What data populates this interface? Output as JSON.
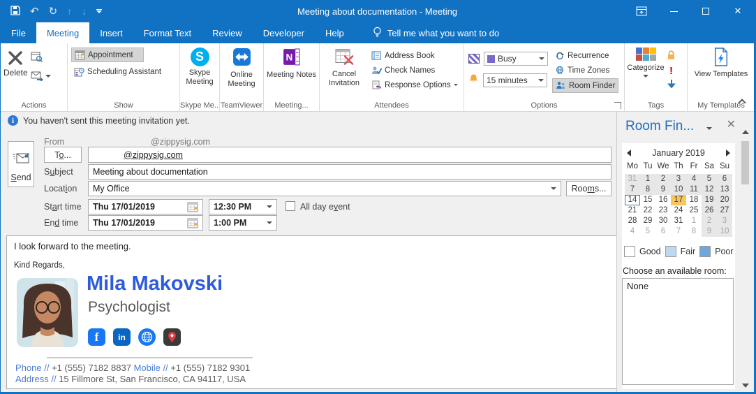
{
  "colors": {
    "accent": "#1172C4",
    "selected_day": "#F7C75C",
    "busy_status": "#7A68C8",
    "name_blue": "#2E5BDB",
    "link_blue": "#4A7DD6"
  },
  "window": {
    "title": "Meeting about documentation  -  Meeting"
  },
  "tabs": [
    {
      "label": "File",
      "selected": false
    },
    {
      "label": "Meeting",
      "selected": true
    },
    {
      "label": "Insert",
      "selected": false
    },
    {
      "label": "Format Text",
      "selected": false
    },
    {
      "label": "Review",
      "selected": false
    },
    {
      "label": "Developer",
      "selected": false
    },
    {
      "label": "Help",
      "selected": false
    }
  ],
  "tellme": "Tell me what you want to do",
  "ribbon": {
    "actions": {
      "label": "Actions",
      "delete": "Delete"
    },
    "show": {
      "label": "Show",
      "appointment": "Appointment",
      "scheduling": "Scheduling Assistant"
    },
    "skype": {
      "label": "Skype Me...",
      "button": "Skype Meeting"
    },
    "teamviewer": {
      "label": "TeamViewer",
      "button": "Online Meeting"
    },
    "notes": {
      "label": "Meeting...",
      "button": "Meeting Notes"
    },
    "attendees": {
      "label": "Attendees",
      "cancel": "Cancel Invitation",
      "address_book": "Address Book",
      "check_names": "Check Names",
      "response_options": "Response Options"
    },
    "options": {
      "label": "Options",
      "busy": "Busy",
      "reminder": "15 minutes",
      "recurrence": "Recurrence",
      "time_zones": "Time Zones",
      "room_finder": "Room Finder"
    },
    "tags": {
      "label": "Tags",
      "categorize": "Categorize"
    },
    "templates": {
      "label": "My Templates",
      "button": "View Templates"
    }
  },
  "infobar": {
    "text": "You haven't sent this meeting invitation yet."
  },
  "form": {
    "send": "Send",
    "from_label": "From",
    "from_value": "@zippysig.com",
    "to_button": "To...",
    "to_value": "@zippysig.com",
    "subject_label": "Subject",
    "subject_value": "Meeting about documentation",
    "location_label": "Location",
    "location_value": "My Office",
    "rooms_button": "Rooms...",
    "start_label": "Start time",
    "start_date": "Thu 17/01/2019",
    "start_time": "12:30 PM",
    "all_day": "All day event",
    "end_label": "End time",
    "end_date": "Thu 17/01/2019",
    "end_time": "1:00 PM"
  },
  "message": {
    "greeting": "I look forward to the meeting.",
    "signoff": "Kind Regards,",
    "name": "Mila Makovski",
    "role": "Psychologist",
    "phone_label": "Phone",
    "sep": "//",
    "phone_value": "+1 (555) 7182 8837",
    "mobile_label": "Mobile",
    "mobile_value": "+1 (555) 7182 9301",
    "address_label": "Address",
    "address_value": "15 Fillmore St, San Francisco, CA 94117, USA"
  },
  "room_finder": {
    "title": "Room Fin...",
    "month": "January 2019",
    "weekdays": [
      "Mo",
      "Tu",
      "We",
      "Th",
      "Fr",
      "Sa",
      "Su"
    ],
    "days": [
      {
        "d": "31",
        "c": "muted shaded"
      },
      {
        "d": "1",
        "c": "shaded"
      },
      {
        "d": "2",
        "c": "shaded"
      },
      {
        "d": "3",
        "c": "shaded"
      },
      {
        "d": "4",
        "c": "shaded"
      },
      {
        "d": "5",
        "c": "shaded"
      },
      {
        "d": "6",
        "c": "shaded"
      },
      {
        "d": "7",
        "c": "shaded"
      },
      {
        "d": "8",
        "c": "shaded"
      },
      {
        "d": "9",
        "c": "shaded"
      },
      {
        "d": "10",
        "c": "shaded"
      },
      {
        "d": "11",
        "c": "shaded"
      },
      {
        "d": "12",
        "c": "shaded"
      },
      {
        "d": "13",
        "c": "shaded"
      },
      {
        "d": "14",
        "c": "today"
      },
      {
        "d": "15",
        "c": ""
      },
      {
        "d": "16",
        "c": ""
      },
      {
        "d": "17",
        "c": "selected"
      },
      {
        "d": "18",
        "c": ""
      },
      {
        "d": "19",
        "c": "shaded"
      },
      {
        "d": "20",
        "c": "shaded"
      },
      {
        "d": "21",
        "c": ""
      },
      {
        "d": "22",
        "c": ""
      },
      {
        "d": "23",
        "c": ""
      },
      {
        "d": "24",
        "c": ""
      },
      {
        "d": "25",
        "c": ""
      },
      {
        "d": "26",
        "c": "shaded"
      },
      {
        "d": "27",
        "c": "shaded"
      },
      {
        "d": "28",
        "c": ""
      },
      {
        "d": "29",
        "c": ""
      },
      {
        "d": "30",
        "c": ""
      },
      {
        "d": "31",
        "c": ""
      },
      {
        "d": "1",
        "c": "muted"
      },
      {
        "d": "2",
        "c": "muted shaded"
      },
      {
        "d": "3",
        "c": "muted shaded"
      },
      {
        "d": "4",
        "c": "muted"
      },
      {
        "d": "5",
        "c": "muted"
      },
      {
        "d": "6",
        "c": "muted"
      },
      {
        "d": "7",
        "c": "muted"
      },
      {
        "d": "8",
        "c": "muted"
      },
      {
        "d": "9",
        "c": "muted shaded"
      },
      {
        "d": "10",
        "c": "muted shaded"
      }
    ],
    "legend": [
      {
        "label": "Good",
        "color": "#FFFFFF"
      },
      {
        "label": "Fair",
        "color": "#BDD9F1"
      },
      {
        "label": "Poor",
        "color": "#6FA7D8"
      }
    ],
    "choose_label": "Choose an available room:",
    "rooms": [
      "None"
    ]
  }
}
